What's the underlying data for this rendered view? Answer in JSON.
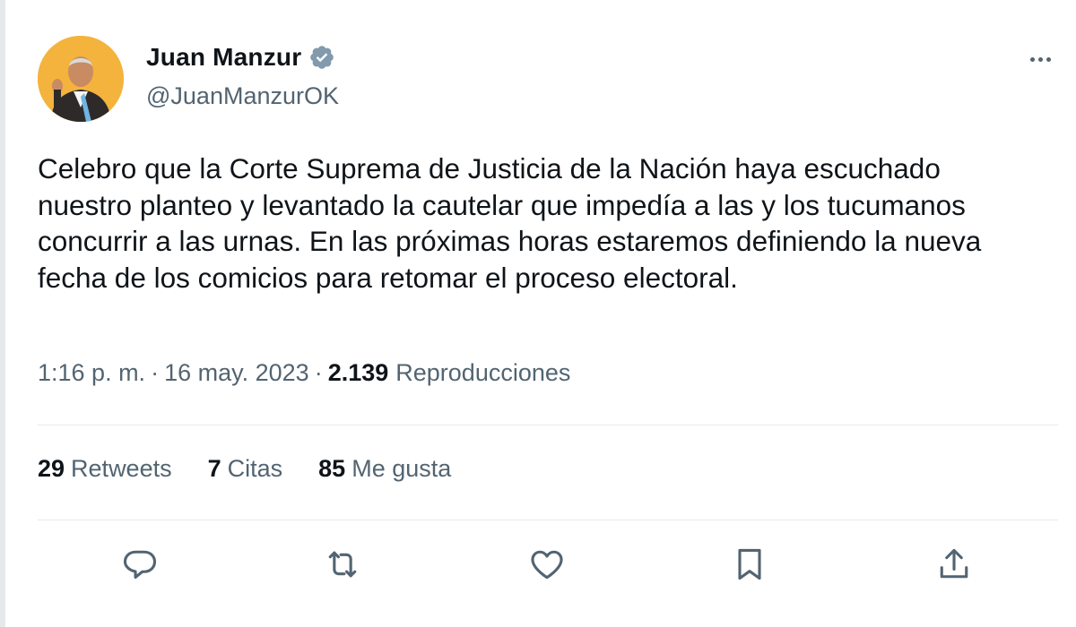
{
  "author": {
    "display_name": "Juan Manzur",
    "handle": "@JuanManzurOK",
    "verified": true
  },
  "tweet": {
    "text": "Celebro que la Corte Suprema de Justicia de la Nación haya escuchado nuestro planteo y levantado la cautelar que impedía a las y los tucumanos concurrir a las urnas. En las próximas horas estaremos definiendo la nueva fecha de los comicios para retomar el proceso electoral.",
    "time": "1:16 p. m.",
    "date": "16 may. 2023",
    "views_count": "2.139",
    "views_label": "Reproducciones"
  },
  "stats": {
    "retweets_count": "29",
    "retweets_label": "Retweets",
    "quotes_count": "7",
    "quotes_label": "Citas",
    "likes_count": "85",
    "likes_label": "Me gusta"
  },
  "icons": {
    "verified": "verified-badge-icon",
    "more": "more-options-icon",
    "reply": "reply-icon",
    "retweet": "retweet-icon",
    "like": "like-heart-icon",
    "bookmark": "bookmark-icon",
    "share": "share-icon"
  },
  "colors": {
    "text_primary": "#0f1419",
    "text_secondary": "#536471",
    "verified_badge": "#829aab",
    "divider": "#e6e9ec",
    "avatar_background": "#f3b33d"
  }
}
